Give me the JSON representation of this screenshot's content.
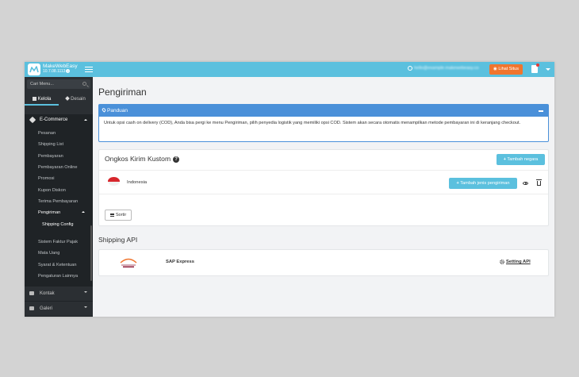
{
  "topbar": {
    "brand_name": "MakeWebEasy",
    "version": "10.7.08.1113",
    "user_email": "hello@example.makewebeasy.co",
    "view_site_label": "Lihat Situs"
  },
  "sidebar": {
    "search_placeholder": "Cari Menu...",
    "tabs": [
      {
        "label": "Kelola",
        "icon": "grid-icon"
      },
      {
        "label": "Desain",
        "icon": "pencil-icon"
      }
    ],
    "section": {
      "label": "E-Commerce",
      "icon": "tag-icon"
    },
    "items": [
      {
        "label": "Pesanan"
      },
      {
        "label": "Shipping List"
      },
      {
        "label": "Pembayaran"
      },
      {
        "label": "Pembayaran Online"
      },
      {
        "label": "Promosi"
      },
      {
        "label": "Kupon Diskon"
      },
      {
        "label": "Terima Pembayaran"
      },
      {
        "label": "Pengiriman"
      },
      {
        "label": "Shipping Config"
      },
      {
        "label": "Sistem Faktur Pajak"
      },
      {
        "label": "Mata Uang"
      },
      {
        "label": "Syarat & Ketentuan"
      },
      {
        "label": "Pengaturan Lainnya"
      }
    ],
    "other_sections": [
      {
        "label": "Kontak",
        "icon": "envelope-icon"
      },
      {
        "label": "Galeri",
        "icon": "image-icon"
      }
    ]
  },
  "main": {
    "page_title": "Pengiriman",
    "guide": {
      "title": "Panduan",
      "body": "Untuk opsi cash on delivery (COD), Anda bisa pergi ke menu Pengiriman, pilih penyedia logistik yang memiliki opsi COD. Sistem akan secara otomatis menampilkan metode pembayaran ini di keranjang checkout."
    },
    "custom_shipping": {
      "title": "Ongkos Kirim Kustom",
      "add_country_label": "Tambah negara",
      "country": "Indonesia",
      "add_type_label": "Tambah jenis pengiriman",
      "sort_label": "Sortir"
    },
    "shipping_api": {
      "title": "Shipping API",
      "provider": "SAP Express",
      "setting_label": "Setting API"
    }
  },
  "colors": {
    "topbar": "#5bc0de",
    "view_site": "#f0752e",
    "guide": "#4a90d9",
    "sidebar": "#2b2f33"
  }
}
